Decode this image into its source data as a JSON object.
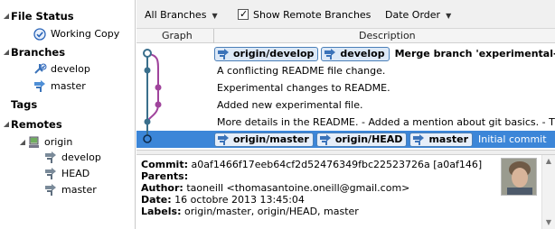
{
  "sidebar": {
    "file_status": {
      "label": "File Status",
      "items": [
        {
          "label": "Working Copy"
        }
      ]
    },
    "branches": {
      "label": "Branches",
      "items": [
        {
          "label": "develop"
        },
        {
          "label": "master"
        }
      ]
    },
    "tags": {
      "label": "Tags"
    },
    "remotes": {
      "label": "Remotes",
      "remote": {
        "label": "origin"
      },
      "items": [
        {
          "label": "develop"
        },
        {
          "label": "HEAD"
        },
        {
          "label": "master"
        }
      ]
    }
  },
  "toolbar": {
    "branches_filter": "All Branches",
    "show_remote": "Show Remote Branches",
    "show_remote_checked": true,
    "order": "Date Order"
  },
  "columns": {
    "graph": "Graph",
    "description": "Description"
  },
  "commits": [
    {
      "tags": [
        "origin/develop",
        "develop"
      ],
      "message": "Merge branch 'experimental-test' in",
      "bold": true,
      "selected": false
    },
    {
      "tags": [],
      "message": "A conflicting README file change.",
      "bold": false,
      "selected": false
    },
    {
      "tags": [],
      "message": "Experimental changes to README.",
      "bold": false,
      "selected": false
    },
    {
      "tags": [],
      "message": "Added new experimental file.",
      "bold": false,
      "selected": false
    },
    {
      "tags": [],
      "message": "More details in the README. - Added a mention about git basics. - This",
      "bold": false,
      "selected": false
    },
    {
      "tags": [
        "origin/master",
        "origin/HEAD",
        "master"
      ],
      "message": "Initial commit",
      "bold": false,
      "selected": true
    }
  ],
  "details": {
    "commit_label": "Commit:",
    "commit_value": "a0af1466f17eeb64cf2d52476349fbc22523726a [a0af146]",
    "parents_label": "Parents:",
    "author_label": "Author:",
    "author_value": "taoneill <thomasantoine.oneill@gmail.com>",
    "date_label": "Date:",
    "date_value": "16 octobre 2013 13:45:04",
    "labels_label": "Labels:",
    "labels_value": "origin/master, origin/HEAD, master"
  },
  "colors": {
    "selection": "#3c86d8",
    "graph_main": "#3a6f8c",
    "graph_branch": "#a0449c",
    "tag_bg": "#dde9f7"
  }
}
